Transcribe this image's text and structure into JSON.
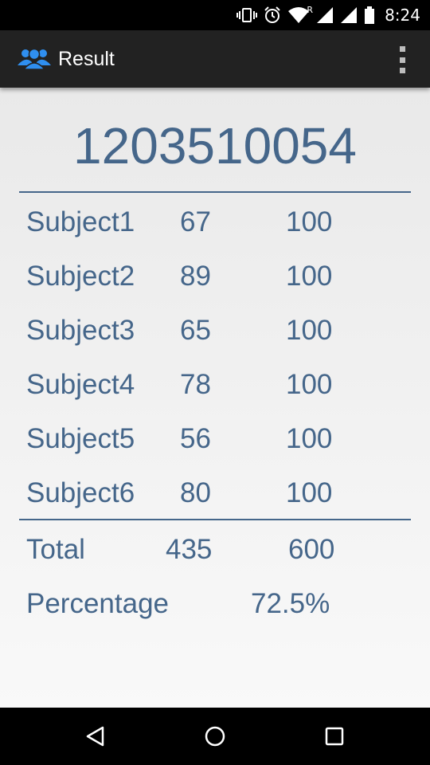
{
  "status_bar": {
    "time": "8:24",
    "network_label": "R",
    "icons": [
      "vibrate-icon",
      "alarm-icon",
      "wifi-icon",
      "signal-icon",
      "signal-icon",
      "battery-icon"
    ]
  },
  "app_bar": {
    "title": "Result",
    "logo_icon": "users-icon",
    "menu_icon": "overflow-menu-icon"
  },
  "result": {
    "roll_number": "1203510054",
    "subjects": [
      {
        "name": "Subject1",
        "marks": "67",
        "max": "100"
      },
      {
        "name": "Subject2",
        "marks": "89",
        "max": "100"
      },
      {
        "name": "Subject3",
        "marks": "65",
        "max": "100"
      },
      {
        "name": "Subject4",
        "marks": "78",
        "max": "100"
      },
      {
        "name": "Subject5",
        "marks": "56",
        "max": "100"
      },
      {
        "name": "Subject6",
        "marks": "80",
        "max": "100"
      }
    ],
    "total": {
      "label": "Total",
      "marks": "435",
      "max": "600"
    },
    "percentage": {
      "label": "Percentage",
      "value": "72.5%"
    }
  },
  "nav_bar": {
    "icons": [
      "back-icon",
      "home-icon",
      "recent-apps-icon"
    ]
  },
  "colors": {
    "accent_text": "#45668a",
    "app_bar": "#222222",
    "logo_blue": "#2f8ff0"
  }
}
